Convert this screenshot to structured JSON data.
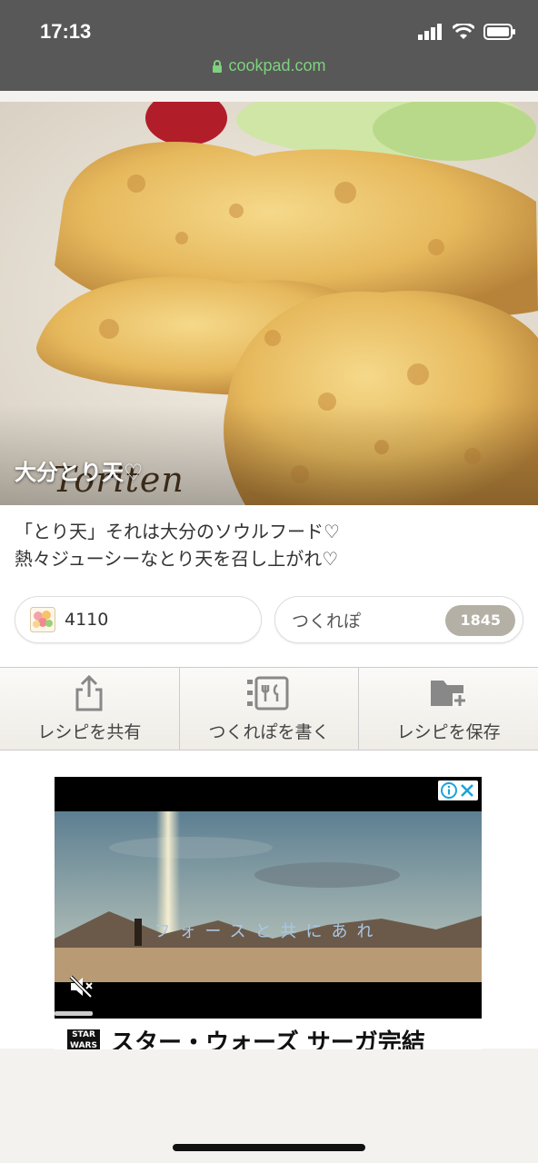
{
  "status": {
    "time": "17:13",
    "url": "cookpad.com"
  },
  "recipe": {
    "title": "大分とり天♡",
    "title_script": "Toriten",
    "description": [
      "「とり天」それは大分のソウルフード♡",
      "熱々ジューシーなとり天を召し上がれ♡"
    ],
    "likes": "4110",
    "tsukurepo_label": "つくれぽ",
    "tsukurepo_count": "1845"
  },
  "actions": [
    {
      "label": "レシピを共有",
      "icon": "share-icon"
    },
    {
      "label": "つくれぽを書く",
      "icon": "write-report-icon"
    },
    {
      "label": "レシピを保存",
      "icon": "folder-add-icon"
    }
  ],
  "ad": {
    "caption": "フォースと共にあれ",
    "logo": "STAR WARS",
    "headline": "スター・ウォーズ サーガ完結"
  },
  "colors": {
    "status_bg": "#585858",
    "url_green": "#7fd07f",
    "badge_bg": "#b4b0a6"
  }
}
